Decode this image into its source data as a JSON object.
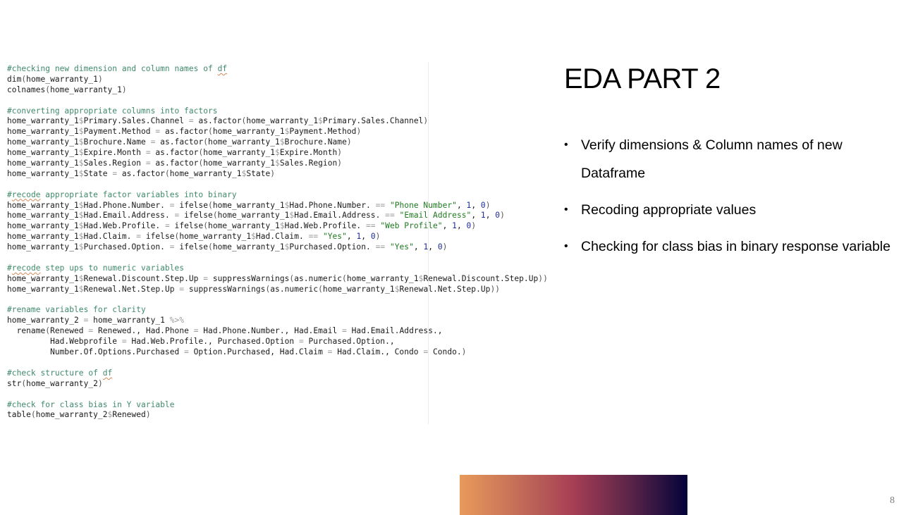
{
  "slide": {
    "title": "EDA PART 2",
    "bullets": [
      "Verify dimensions & Column names of new Dataframe",
      "Recoding appropriate values",
      "Checking for class bias in binary response variable"
    ],
    "page_number": "8",
    "gradient_colors": [
      "#e89a5a",
      "#a63e55",
      "#03033a"
    ]
  },
  "code": {
    "lines": [
      [
        [
          "c",
          "#checking new dimension and column names of "
        ],
        [
          "cs",
          "df"
        ]
      ],
      [
        [
          "t",
          "dim"
        ],
        [
          "p",
          "("
        ],
        [
          "t",
          "home_warranty_1"
        ],
        [
          "p",
          ")"
        ]
      ],
      [
        [
          "t",
          "colnames"
        ],
        [
          "p",
          "("
        ],
        [
          "t",
          "home_warranty_1"
        ],
        [
          "p",
          ")"
        ]
      ],
      [],
      [
        [
          "c",
          "#converting appropriate columns into factors"
        ]
      ],
      [
        [
          "t",
          "home_warranty_1"
        ],
        [
          "d",
          "$"
        ],
        [
          "t",
          "Primary.Sales.Channel "
        ],
        [
          "o",
          "="
        ],
        [
          "t",
          " as.factor"
        ],
        [
          "p",
          "("
        ],
        [
          "t",
          "home_warranty_1"
        ],
        [
          "d",
          "$"
        ],
        [
          "t",
          "Primary.Sales.Channel"
        ],
        [
          "p",
          ")"
        ]
      ],
      [
        [
          "t",
          "home_warranty_1"
        ],
        [
          "d",
          "$"
        ],
        [
          "t",
          "Payment.Method "
        ],
        [
          "o",
          "="
        ],
        [
          "t",
          " as.factor"
        ],
        [
          "p",
          "("
        ],
        [
          "t",
          "home_warranty_1"
        ],
        [
          "d",
          "$"
        ],
        [
          "t",
          "Payment.Method"
        ],
        [
          "p",
          ")"
        ]
      ],
      [
        [
          "t",
          "home_warranty_1"
        ],
        [
          "d",
          "$"
        ],
        [
          "t",
          "Brochure.Name "
        ],
        [
          "o",
          "="
        ],
        [
          "t",
          " as.factor"
        ],
        [
          "p",
          "("
        ],
        [
          "t",
          "home_warranty_1"
        ],
        [
          "d",
          "$"
        ],
        [
          "t",
          "Brochure.Name"
        ],
        [
          "p",
          ")"
        ]
      ],
      [
        [
          "t",
          "home_warranty_1"
        ],
        [
          "d",
          "$"
        ],
        [
          "t",
          "Expire.Month "
        ],
        [
          "o",
          "="
        ],
        [
          "t",
          " as.factor"
        ],
        [
          "p",
          "("
        ],
        [
          "t",
          "home_warranty_1"
        ],
        [
          "d",
          "$"
        ],
        [
          "t",
          "Expire.Month"
        ],
        [
          "p",
          ")"
        ]
      ],
      [
        [
          "t",
          "home_warranty_1"
        ],
        [
          "d",
          "$"
        ],
        [
          "t",
          "Sales.Region "
        ],
        [
          "o",
          "="
        ],
        [
          "t",
          " as.factor"
        ],
        [
          "p",
          "("
        ],
        [
          "t",
          "home_warranty_1"
        ],
        [
          "d",
          "$"
        ],
        [
          "t",
          "Sales.Region"
        ],
        [
          "p",
          ")"
        ]
      ],
      [
        [
          "t",
          "home_warranty_1"
        ],
        [
          "d",
          "$"
        ],
        [
          "t",
          "State "
        ],
        [
          "o",
          "="
        ],
        [
          "t",
          " as.factor"
        ],
        [
          "p",
          "("
        ],
        [
          "t",
          "home_warranty_1"
        ],
        [
          "d",
          "$"
        ],
        [
          "t",
          "State"
        ],
        [
          "p",
          ")"
        ]
      ],
      [],
      [
        [
          "c",
          "#"
        ],
        [
          "cs",
          "recode"
        ],
        [
          "c",
          " appropriate factor variables into binary"
        ]
      ],
      [
        [
          "t",
          "home_warranty_1"
        ],
        [
          "d",
          "$"
        ],
        [
          "t",
          "Had.Phone.Number. "
        ],
        [
          "o",
          "="
        ],
        [
          "t",
          " ifelse"
        ],
        [
          "p",
          "("
        ],
        [
          "t",
          "home_warranty_1"
        ],
        [
          "d",
          "$"
        ],
        [
          "t",
          "Had.Phone.Number. "
        ],
        [
          "o",
          "=="
        ],
        [
          "t",
          " "
        ],
        [
          "s",
          "\"Phone Number\""
        ],
        [
          "t",
          ", "
        ],
        [
          "n",
          "1"
        ],
        [
          "t",
          ", "
        ],
        [
          "n",
          "0"
        ],
        [
          "p",
          ")"
        ]
      ],
      [
        [
          "t",
          "home_warranty_1"
        ],
        [
          "d",
          "$"
        ],
        [
          "t",
          "Had.Email.Address. "
        ],
        [
          "o",
          "="
        ],
        [
          "t",
          " ifelse"
        ],
        [
          "p",
          "("
        ],
        [
          "t",
          "home_warranty_1"
        ],
        [
          "d",
          "$"
        ],
        [
          "t",
          "Had.Email.Address. "
        ],
        [
          "o",
          "=="
        ],
        [
          "t",
          " "
        ],
        [
          "s",
          "\"Email Address\""
        ],
        [
          "t",
          ", "
        ],
        [
          "n",
          "1"
        ],
        [
          "t",
          ", "
        ],
        [
          "n",
          "0"
        ],
        [
          "p",
          ")"
        ]
      ],
      [
        [
          "t",
          "home_warranty_1"
        ],
        [
          "d",
          "$"
        ],
        [
          "t",
          "Had.Web.Profile. "
        ],
        [
          "o",
          "="
        ],
        [
          "t",
          " ifelse"
        ],
        [
          "p",
          "("
        ],
        [
          "t",
          "home_warranty_1"
        ],
        [
          "d",
          "$"
        ],
        [
          "t",
          "Had.Web.Profile. "
        ],
        [
          "o",
          "=="
        ],
        [
          "t",
          " "
        ],
        [
          "s",
          "\"Web Profile\""
        ],
        [
          "t",
          ", "
        ],
        [
          "n",
          "1"
        ],
        [
          "t",
          ", "
        ],
        [
          "n",
          "0"
        ],
        [
          "p",
          ")"
        ]
      ],
      [
        [
          "t",
          "home_warranty_1"
        ],
        [
          "d",
          "$"
        ],
        [
          "t",
          "Had.Claim. "
        ],
        [
          "o",
          "="
        ],
        [
          "t",
          " ifelse"
        ],
        [
          "p",
          "("
        ],
        [
          "t",
          "home_warranty_1"
        ],
        [
          "d",
          "$"
        ],
        [
          "t",
          "Had.Claim. "
        ],
        [
          "o",
          "=="
        ],
        [
          "t",
          " "
        ],
        [
          "s",
          "\"Yes\""
        ],
        [
          "t",
          ", "
        ],
        [
          "n",
          "1"
        ],
        [
          "t",
          ", "
        ],
        [
          "n",
          "0"
        ],
        [
          "p",
          ")"
        ]
      ],
      [
        [
          "t",
          "home_warranty_1"
        ],
        [
          "d",
          "$"
        ],
        [
          "t",
          "Purchased.Option. "
        ],
        [
          "o",
          "="
        ],
        [
          "t",
          " ifelse"
        ],
        [
          "p",
          "("
        ],
        [
          "t",
          "home_warranty_1"
        ],
        [
          "d",
          "$"
        ],
        [
          "t",
          "Purchased.Option. "
        ],
        [
          "o",
          "=="
        ],
        [
          "t",
          " "
        ],
        [
          "s",
          "\"Yes\""
        ],
        [
          "t",
          ", "
        ],
        [
          "n",
          "1"
        ],
        [
          "t",
          ", "
        ],
        [
          "n",
          "0"
        ],
        [
          "p",
          ")"
        ]
      ],
      [],
      [
        [
          "c",
          "#"
        ],
        [
          "cs",
          "recode"
        ],
        [
          "c",
          " step ups to numeric variables"
        ]
      ],
      [
        [
          "t",
          "home_warranty_1"
        ],
        [
          "d",
          "$"
        ],
        [
          "t",
          "Renewal.Discount.Step.Up "
        ],
        [
          "o",
          "="
        ],
        [
          "t",
          " suppressWarnings"
        ],
        [
          "p",
          "("
        ],
        [
          "t",
          "as.numeric"
        ],
        [
          "p",
          "("
        ],
        [
          "t",
          "home_warranty_1"
        ],
        [
          "d",
          "$"
        ],
        [
          "t",
          "Renewal.Discount.Step.Up"
        ],
        [
          "p",
          "))"
        ]
      ],
      [
        [
          "t",
          "home_warranty_1"
        ],
        [
          "d",
          "$"
        ],
        [
          "t",
          "Renewal.Net.Step.Up "
        ],
        [
          "o",
          "="
        ],
        [
          "t",
          " suppressWarnings"
        ],
        [
          "p",
          "("
        ],
        [
          "t",
          "as.numeric"
        ],
        [
          "p",
          "("
        ],
        [
          "t",
          "home_warranty_1"
        ],
        [
          "d",
          "$"
        ],
        [
          "t",
          "Renewal.Net.Step.Up"
        ],
        [
          "p",
          "))"
        ]
      ],
      [],
      [
        [
          "c",
          "#rename variables for clarity"
        ]
      ],
      [
        [
          "t",
          "home_warranty_2 "
        ],
        [
          "o",
          "="
        ],
        [
          "t",
          " home_warranty_1 "
        ],
        [
          "o",
          "%>%"
        ]
      ],
      [
        [
          "t",
          "  rename"
        ],
        [
          "p",
          "("
        ],
        [
          "t",
          "Renewed "
        ],
        [
          "o",
          "="
        ],
        [
          "t",
          " Renewed., Had.Phone "
        ],
        [
          "o",
          "="
        ],
        [
          "t",
          " Had.Phone.Number., Had.Email "
        ],
        [
          "o",
          "="
        ],
        [
          "t",
          " Had.Email.Address.,"
        ]
      ],
      [
        [
          "t",
          "         Had.Webprofile "
        ],
        [
          "o",
          "="
        ],
        [
          "t",
          " Had.Web.Profile., Purchased.Option "
        ],
        [
          "o",
          "="
        ],
        [
          "t",
          " Purchased.Option.,"
        ]
      ],
      [
        [
          "t",
          "         Number.Of.Options.Purchased "
        ],
        [
          "o",
          "="
        ],
        [
          "t",
          " Option.Purchased, Had.Claim "
        ],
        [
          "o",
          "="
        ],
        [
          "t",
          " Had.Claim., Condo "
        ],
        [
          "o",
          "="
        ],
        [
          "t",
          " Condo."
        ],
        [
          "p",
          ")"
        ]
      ],
      [],
      [
        [
          "c",
          "#check structure of "
        ],
        [
          "cs",
          "df"
        ]
      ],
      [
        [
          "t",
          "str"
        ],
        [
          "p",
          "("
        ],
        [
          "t",
          "home_warranty_2"
        ],
        [
          "p",
          ")"
        ]
      ],
      [],
      [
        [
          "c",
          "#check for class bias in Y variable"
        ]
      ],
      [
        [
          "t",
          "table"
        ],
        [
          "p",
          "("
        ],
        [
          "t",
          "home_warranty_2"
        ],
        [
          "d",
          "$"
        ],
        [
          "t",
          "Renewed"
        ],
        [
          "p",
          ")"
        ]
      ]
    ]
  }
}
